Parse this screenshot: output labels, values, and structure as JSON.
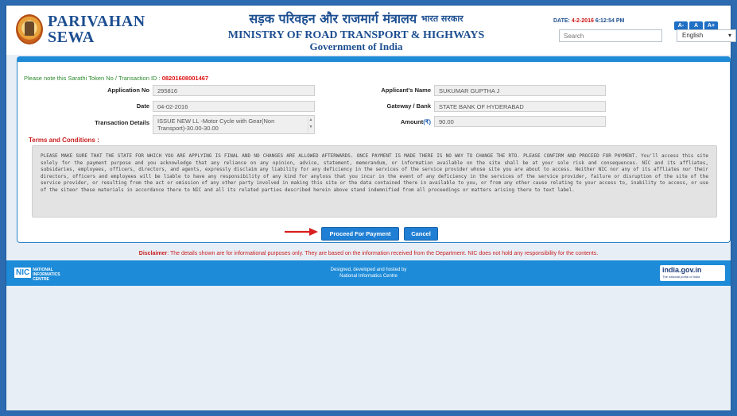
{
  "header": {
    "brand_line1": "PARIVAHAN",
    "brand_line2": "SEWA",
    "hindi_title": "सड़क परिवहन और राजमार्ग मंत्रालय",
    "hindi_gov": "भारत सरकार",
    "ministry": "MINISTRY OF ROAD TRANSPORT & HIGHWAYS",
    "government": "Government of India",
    "date_label": "DATE:",
    "date_value": "4-2-2016",
    "time_value": "6:12:54 PM",
    "font_buttons": [
      "A-",
      "A",
      "A+"
    ],
    "search_placeholder": "Search",
    "language": "English"
  },
  "form": {
    "token_label": "Please note this Sarathi Token No / Transaction ID :",
    "token_value": "08201608001467",
    "application_no_label": "Application No",
    "application_no": "295816",
    "date_label": "Date",
    "date": "04-02-2016",
    "transaction_details_label": "Transaction Details",
    "transaction_details": "ISSUE NEW LL  -Motor Cycle with Gear(Non Transport)-30.00-30.00",
    "applicant_name_label": "Applicant's Name",
    "applicant_name": "SUKUMAR GUPTHA J",
    "gateway_label": "Gateway / Bank",
    "gateway": "STATE BANK OF HYDERABAD",
    "amount_label": "Amount",
    "amount_symbol": "(₹)",
    "amount": "90.00",
    "terms_heading": "Terms and Conditions :",
    "terms_text": "PLEASE MAKE SURE THAT THE STATE FOR WHICH YOU ARE APPLYING IS FINAL AND NO CHANGES ARE ALLOWED AFTERWARDS. ONCE PAYMENT IS MADE THERE IS NO WAY TO CHANGE THE RTO. PLEASE CONFIRM AND PROCEED FOR PAYMENT. You'll access this site solely for the payment purpose and you acknowledge that any reliance on any opinion, advice, statement, memorandum, or information available on the site shall be at your sole risk and consequences. NIC and its affliates, subsidaries, employees, officers, directors, and agents, expressly disclaim any liability for any deficiency in the services of the service provider whose site you are about to access. Neither NIC nor any of its affliates nor their directors, officers and employees will be liable to have any responsibility of any kind for anyloss that you incur in the event of any deficiency in the services of the service provider, failure or disruption of the site of the service provider, or resulting from the act or omission of any other party involved in making this site or the data contained there in available to you, or from any other cause relating to your access to, inability to access, or use of the siteor these materials in accordance there to NIC and all its related parties described herein above stand indemnified from all proceedings or matters arising there to text label.",
    "proceed_button": "Proceed For Payment",
    "cancel_button": "Cancel"
  },
  "disclaimer": {
    "label": "Disclaimer",
    "text": ": The details shown are for informational purposes only. They are based on the information received from the Department. NIC does not hold any responsibility for the contents."
  },
  "footer": {
    "nic_short": "NIC",
    "nic_line1": "NATIONAL",
    "nic_line2": "INFORMATICS",
    "nic_line3": "CENTRE",
    "designed_line1": "Designed, developed and hosted by",
    "designed_line2": "National Informatics Centre",
    "india_gov": "india.gov.in",
    "india_gov_tag": "The national portal of India"
  },
  "colors": {
    "primary_blue": "#1f8ad6",
    "accent_red": "#c81e1e",
    "token_green": "#2c8a2c"
  }
}
